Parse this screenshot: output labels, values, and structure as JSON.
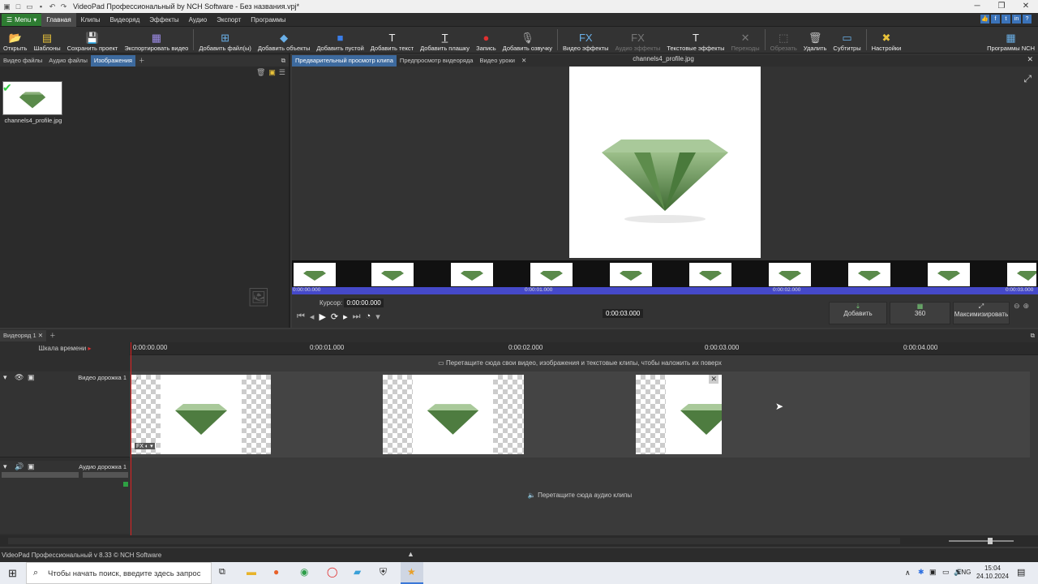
{
  "window": {
    "title": "VideoPad Профессиональный by NCH Software - Без названия.vpj*"
  },
  "menubar": {
    "menu_label": "Menu",
    "tabs": [
      "Главная",
      "Клипы",
      "Видеоряд",
      "Эффекты",
      "Аудио",
      "Экспорт",
      "Программы"
    ],
    "active_tab": "Главная"
  },
  "toolbar": {
    "items": [
      {
        "label": "Открыть",
        "icon": "folder-open-icon"
      },
      {
        "label": "Шаблоны",
        "icon": "templates-icon"
      },
      {
        "label": "Сохранить проект",
        "icon": "save-icon"
      },
      {
        "label": "Экспортировать видео",
        "icon": "export-icon"
      },
      {
        "label": "Добавить файл(ы)",
        "icon": "add-file-icon"
      },
      {
        "label": "Добавить объекты",
        "icon": "add-objects-icon"
      },
      {
        "label": "Добавить пустой",
        "icon": "add-blank-icon"
      },
      {
        "label": "Добавить текст",
        "icon": "add-text-icon"
      },
      {
        "label": "Добавить плашку",
        "icon": "add-title-icon"
      },
      {
        "label": "Запись",
        "icon": "record-icon"
      },
      {
        "label": "Добавить озвучку",
        "icon": "narration-icon"
      },
      {
        "label": "Видео эффекты",
        "icon": "video-fx-icon"
      },
      {
        "label": "Аудио эффекты",
        "icon": "audio-fx-icon"
      },
      {
        "label": "Текстовые эффекты",
        "icon": "text-fx-icon"
      },
      {
        "label": "Переходы",
        "icon": "transitions-icon"
      },
      {
        "label": "Обрезать",
        "icon": "crop-icon"
      },
      {
        "label": "Удалить",
        "icon": "delete-icon"
      },
      {
        "label": "Субтитры",
        "icon": "subtitles-icon"
      },
      {
        "label": "Настройки",
        "icon": "settings-icon"
      }
    ],
    "nch_label": "Программы NCH"
  },
  "bins": {
    "tabs": [
      "Видео файлы",
      "Аудио файлы",
      "Изображения"
    ],
    "active": "Изображения",
    "file_name": "channels4_profile.jpg"
  },
  "preview": {
    "tabs": [
      "Предварительный просмотр клипа",
      "Предпросмотр видеоряда",
      "Видео уроки"
    ],
    "active": "Предварительный просмотр клипа",
    "file_title": "channels4_profile.jpg",
    "ruler": [
      "0:00:00.000",
      "0:00:01.000",
      "0:00:02.000",
      "0:00:03.000"
    ],
    "cursor_label": "Курсор:",
    "cursor_value": "0:00:00.000",
    "duration": "0:00:03.000",
    "add_label": "Добавить",
    "label_360": "360",
    "maximize_label": "Максимизировать"
  },
  "sequence": {
    "tab": "Видеоряд 1",
    "scale_label": "Шкала времени",
    "ruler": [
      "0:00:00.000",
      "0:00:01.000",
      "0:00:02.000",
      "0:00:03.000",
      "0:00:04.000"
    ],
    "overlay_hint": "Перетащите сюда свои видео, изображения и текстовые клипы, чтобы наложить их поверх",
    "video_track": "Видео дорожка 1",
    "audio_track": "Аудио дорожка 1",
    "audio_hint": "Перетащите сюда аудио клипы"
  },
  "status": {
    "text": "VideoPad Профессиональный v 8.33 © NCH Software"
  },
  "taskbar": {
    "search_placeholder": "Чтобы начать поиск, введите здесь запрос",
    "lang": "ENG",
    "time": "15:04",
    "date": "24.10.2024"
  }
}
